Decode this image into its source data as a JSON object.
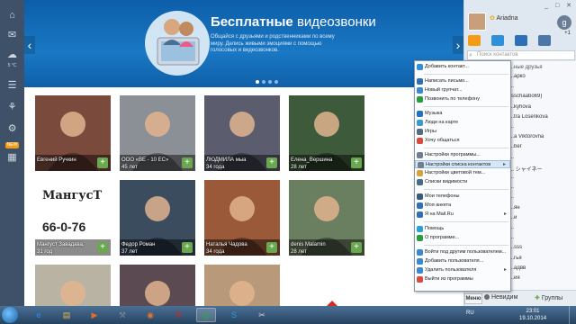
{
  "rail": {
    "weather": "5 °C",
    "weather_label": "Погода",
    "new_badge": "NEW"
  },
  "banner": {
    "headline_bold": "Бесплатные",
    "headline_light": "видеозвонки",
    "description": "Общайся с друзьями и родственниками по всему миру. Делись живыми эмоциями с помощью голосовых и видеозвонков.",
    "slide_count": 4,
    "active_slide": 1
  },
  "tiles": [
    {
      "name": "Евгений Ручкин",
      "age": "",
      "color": "#7a4a3c"
    },
    {
      "name": "ООО «ВЕ - 10 ЕС»",
      "age": "45 лет",
      "color": "#8b8f96"
    },
    {
      "name": "ЛЮДМИЛА мыа",
      "age": "34 года",
      "color": "#5b5d6e"
    },
    {
      "name": "Елена_Вершина",
      "age": "28 лет",
      "color": "#3d5a3a"
    },
    {
      "name": "Мангуст Завадава,",
      "age": "31 год",
      "color": "#ffffff"
    },
    {
      "name": "Федор Роман",
      "age": "37 лет",
      "color": "#3b4c5e"
    },
    {
      "name": "Наталья Чадова",
      "age": "34 года",
      "color": "#9a5a3a"
    },
    {
      "name": "denis Malamin",
      "age": "28 лет",
      "color": "#6a7f60"
    },
    {
      "name": "",
      "age": "",
      "color": "#b9b3a4"
    },
    {
      "name": "",
      "age": "",
      "color": "#5b4a52"
    },
    {
      "name": "",
      "age": "",
      "color": "#b89a7a"
    },
    {
      "name": "",
      "age": "",
      "color": "#ffffff"
    }
  ],
  "mangust": {
    "title": "МангусТ",
    "phone": "66-0-76"
  },
  "panel": {
    "status_label": "Ariadna",
    "window_controls": "_ □ ✕",
    "gplus_label": "+1",
    "search_placeholder": "Поиск контактов",
    "group_header": "...ные друзья",
    "contacts": [
      "...арко",
      "...",
      "(sschaabo69)",
      "...kyhova",
      "...tra Losenkova",
      "...",
      "...a Viktorovna",
      "...ber",
      "...",
      "... シャイネー",
      "...",
      "...",
      "...",
      "...ян",
      "...й",
      "...",
      "...",
      "...sss",
      "...гья",
      "...адвв",
      "...ия"
    ],
    "menu_btn": "Меню",
    "invisible_label": "Невидим",
    "groups_label": "Группы"
  },
  "menu": {
    "items": [
      {
        "label": "Добавить контакт...",
        "icon": "add-contact-icon",
        "color": "#2f8fd8",
        "arrow": false
      },
      {
        "label": "Написать письмо...",
        "icon": "mail-icon",
        "color": "#2f6fb8",
        "arrow": false
      },
      {
        "label": "Новый групчат...",
        "icon": "group-chat-icon",
        "color": "#3b88d0",
        "arrow": false
      },
      {
        "label": "Позвонить по телефону",
        "icon": "phone-icon",
        "color": "#2a9c3c",
        "arrow": false
      },
      {
        "label": "Музыка",
        "icon": "music-icon",
        "color": "#1f73c2",
        "arrow": false
      },
      {
        "label": "Люди на карте",
        "icon": "map-icon",
        "color": "#3a9bd1",
        "arrow": false
      },
      {
        "label": "Игры",
        "icon": "games-icon",
        "color": "#5a6a7a",
        "arrow": false
      },
      {
        "label": "Хочу общаться",
        "icon": "chat-heart-icon",
        "color": "#d84a3a",
        "arrow": false
      },
      {
        "label": "Настройки программы...",
        "icon": "settings-icon",
        "color": "#6f7f90",
        "arrow": false
      },
      {
        "label": "Настройки списка контактов",
        "icon": "list-settings-icon",
        "color": "#6f7f90",
        "arrow": true
      },
      {
        "label": "Настройки цветовой тем...",
        "icon": "palette-icon",
        "color": "#d8a23a",
        "arrow": false
      },
      {
        "label": "Списки видимости",
        "icon": "visibility-icon",
        "color": "#4a6a8a",
        "arrow": false
      },
      {
        "label": "Мои телефоны",
        "icon": "phones-icon",
        "color": "#3a5a7a",
        "arrow": false
      },
      {
        "label": "Моя анкета",
        "icon": "profile-icon",
        "color": "#2f6fb8",
        "arrow": false
      },
      {
        "label": "Я на Mail.Ru",
        "icon": "mailru-icon",
        "color": "#2f6fb8",
        "arrow": true
      },
      {
        "label": "Помощь",
        "icon": "help-icon",
        "color": "#2aa0d8",
        "arrow": false
      },
      {
        "label": "О программе...",
        "icon": "about-icon",
        "color": "#2a9c3c",
        "arrow": false
      },
      {
        "label": "Войти под другим пользователем...",
        "icon": "switch-user-icon",
        "color": "#3b88d0",
        "arrow": false
      },
      {
        "label": "Добавить пользователя...",
        "icon": "add-user-icon",
        "color": "#3b88d0",
        "arrow": false
      },
      {
        "label": "Удалить пользователя",
        "icon": "remove-user-icon",
        "color": "#3b88d0",
        "arrow": true
      },
      {
        "label": "Выйти из программы",
        "icon": "exit-icon",
        "color": "#d84a3a",
        "arrow": false
      }
    ],
    "highlighted_index": 9
  },
  "taskbar": {
    "apps": [
      "ie-icon",
      "explorer-icon",
      "media-player-icon",
      "tools-icon",
      "firefox-icon",
      "yandex-icon",
      "mail-agent-icon",
      "skype-icon",
      "screen-capture-icon"
    ],
    "lang": "RU",
    "time": "23:01",
    "date": "19.10.2014"
  }
}
